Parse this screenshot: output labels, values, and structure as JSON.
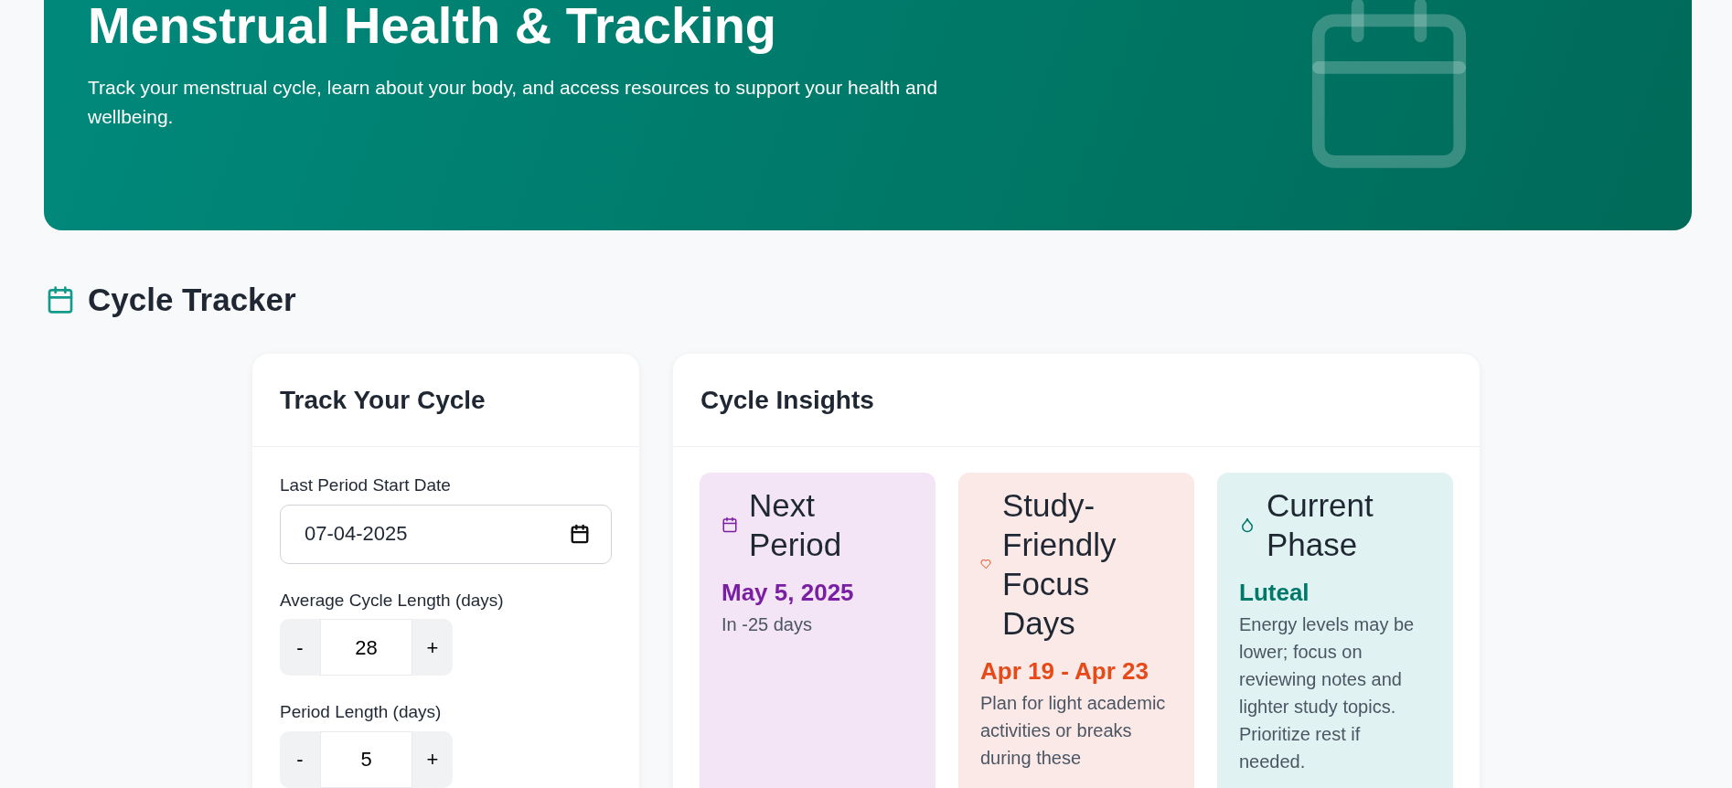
{
  "hero": {
    "title": "Menstrual Health & Tracking",
    "subtitle": "Track your menstrual cycle, learn about your body, and access resources to support your health and wellbeing."
  },
  "section": {
    "title": "Cycle Tracker"
  },
  "tracker": {
    "title": "Track Your Cycle",
    "fields": [
      {
        "kind": "date",
        "label": "Last Period Start Date",
        "value": "07-04-2025"
      },
      {
        "kind": "stepper",
        "label": "Average Cycle Length (days)",
        "value": "28",
        "minus": "-",
        "plus": "+"
      },
      {
        "kind": "stepper",
        "label": "Period Length (days)",
        "value": "5",
        "minus": "-",
        "plus": "+"
      }
    ]
  },
  "insights": {
    "title": "Cycle Insights",
    "cards": [
      {
        "kind": "calendar",
        "title": "Next Period",
        "value": "May 5, 2025",
        "text": "In -25 days",
        "color": "#7b1fa2"
      },
      {
        "kind": "heart",
        "title": "Study-Friendly Focus Days",
        "value": "Apr 19 - Apr 23",
        "text": "Plan for light academic activities or breaks during these",
        "color": "#e64a19"
      },
      {
        "kind": "drop",
        "title": "Current Phase",
        "value": "Luteal",
        "text": "Energy levels may be lower; focus on reviewing notes and lighter study topics. Prioritize rest if needed.",
        "color": "#00796b"
      }
    ]
  }
}
